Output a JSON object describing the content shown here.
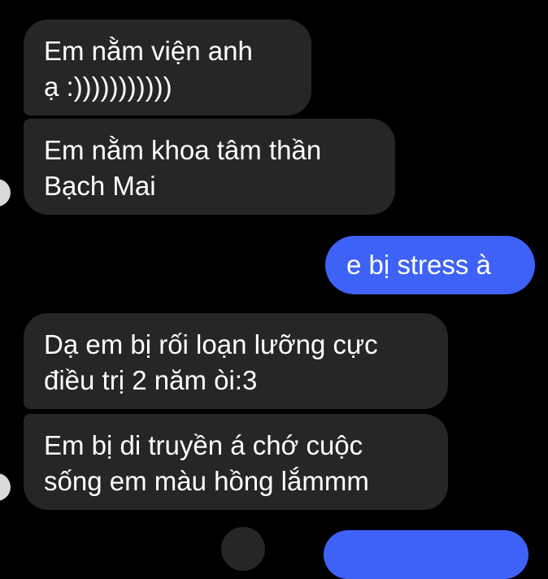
{
  "messages": [
    {
      "id": "m1",
      "direction": "incoming",
      "text": "Em nằm viện anh\nạ :)))))))))))"
    },
    {
      "id": "m2",
      "direction": "incoming",
      "text": "Em nằm khoa tâm thần\nBạch Mai"
    },
    {
      "id": "m3",
      "direction": "outgoing",
      "text": "e bị stress à"
    },
    {
      "id": "m4",
      "direction": "incoming",
      "text": "Dạ em bị rối loạn lưỡng cực\nđiều trị 2 năm òi:3"
    },
    {
      "id": "m5",
      "direction": "incoming",
      "text": "Em bị di truyền á chớ cuộc\nsống em màu hồng lắmmm"
    }
  ],
  "colors": {
    "background": "#000000",
    "incoming_bubble": "#262628",
    "outgoing_bubble": "#3e62f7",
    "text": "#ffffff"
  }
}
